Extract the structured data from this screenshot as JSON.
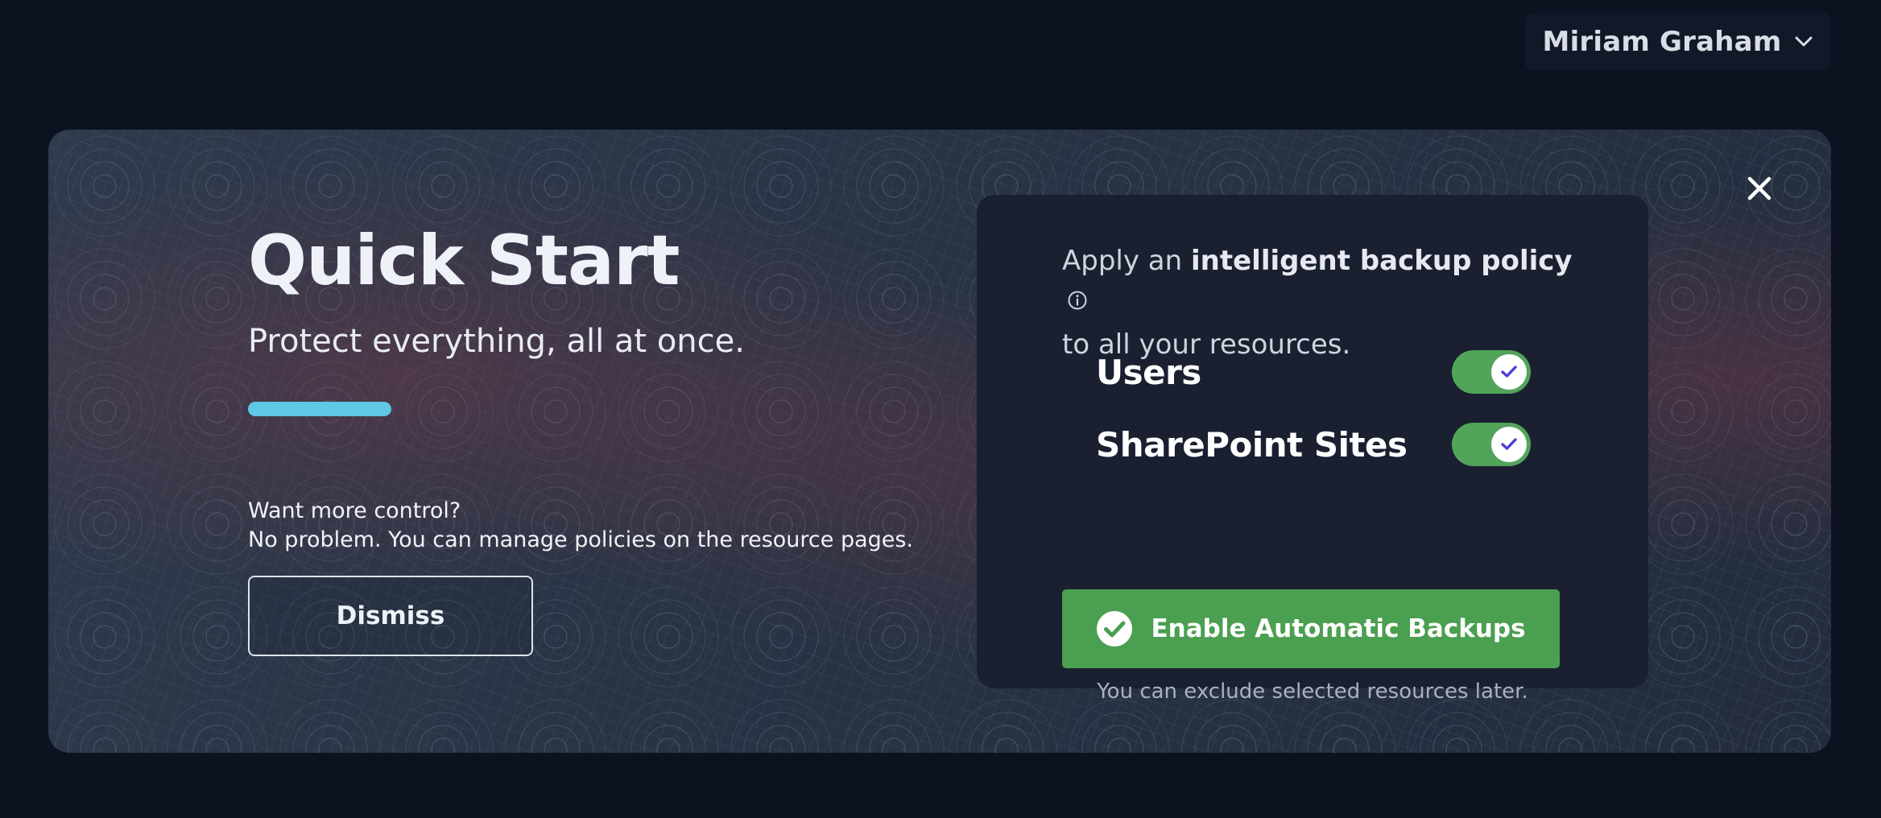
{
  "header": {
    "user_name": "Miriam Graham",
    "user_menu_icon": "chevron-down-icon"
  },
  "quick_start": {
    "title": "Quick Start",
    "subtitle": "Protect everything, all at once.",
    "accent_color": "#5ec8e6",
    "control_question": "Want more control?",
    "control_answer": "No problem. You can manage policies on the resource pages.",
    "dismiss_label": "Dismiss",
    "close_icon": "close-icon"
  },
  "policy_card": {
    "text_prefix": "Apply an ",
    "text_bold": "intelligent backup policy",
    "text_suffix": "to all your resources.",
    "info_icon": "info-icon",
    "toggles": [
      {
        "label": "Users",
        "enabled": true
      },
      {
        "label": "SharePoint Sites",
        "enabled": true
      }
    ],
    "toggle_color": "#52a45a",
    "enable_button_label": "Enable Automatic Backups",
    "enable_button_color": "#4b9f50",
    "hint": "You can exclude selected resources later."
  }
}
